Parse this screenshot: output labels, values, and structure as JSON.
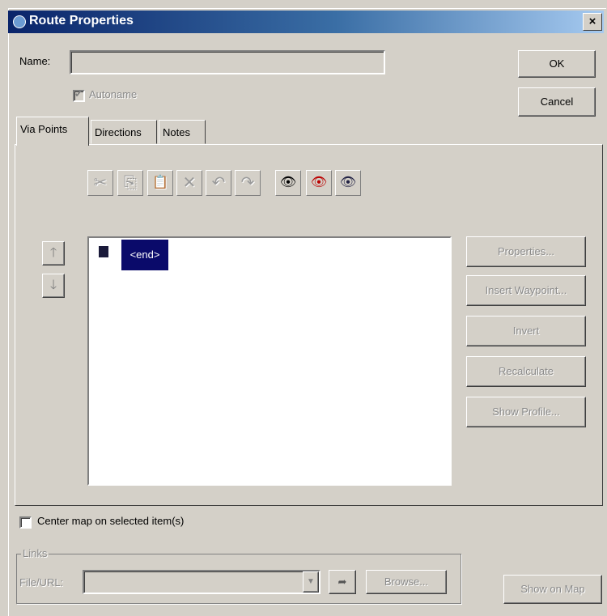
{
  "window": {
    "title": "Route Properties"
  },
  "name_field": {
    "label": "Name:",
    "value": ""
  },
  "autoname": {
    "label": "Autoname",
    "checked": true
  },
  "buttons": {
    "ok": "OK",
    "cancel": "Cancel"
  },
  "tabs": [
    "Via Points",
    "Directions",
    "Notes"
  ],
  "toolbar": {
    "icons": [
      "cut-icon",
      "copy-icon",
      "paste-icon",
      "delete-icon",
      "undo-icon",
      "redo-icon",
      "find-icon",
      "find-near-icon",
      "find-next-icon"
    ],
    "glyphs": [
      "✂",
      "⎘",
      "📋",
      "✕",
      "↶",
      "↷",
      "👁",
      "👁",
      "👁"
    ]
  },
  "via_list": {
    "items": [
      {
        "label": "<end>",
        "selected": true
      }
    ]
  },
  "side_buttons": [
    "Properties...",
    "Insert Waypoint...",
    "Invert",
    "Recalculate",
    "Show Profile..."
  ],
  "center_map": {
    "label": "Center map on selected item(s)",
    "checked": false
  },
  "links": {
    "group_label": "Links",
    "file_url_label": "File/URL:",
    "file_url_value": "",
    "browse_label": "Browse...",
    "show_on_map_label": "Show on Map"
  },
  "colors": {
    "title_start": "#0a246a",
    "title_end": "#a6caf0",
    "selection": "#0a0a6a"
  }
}
